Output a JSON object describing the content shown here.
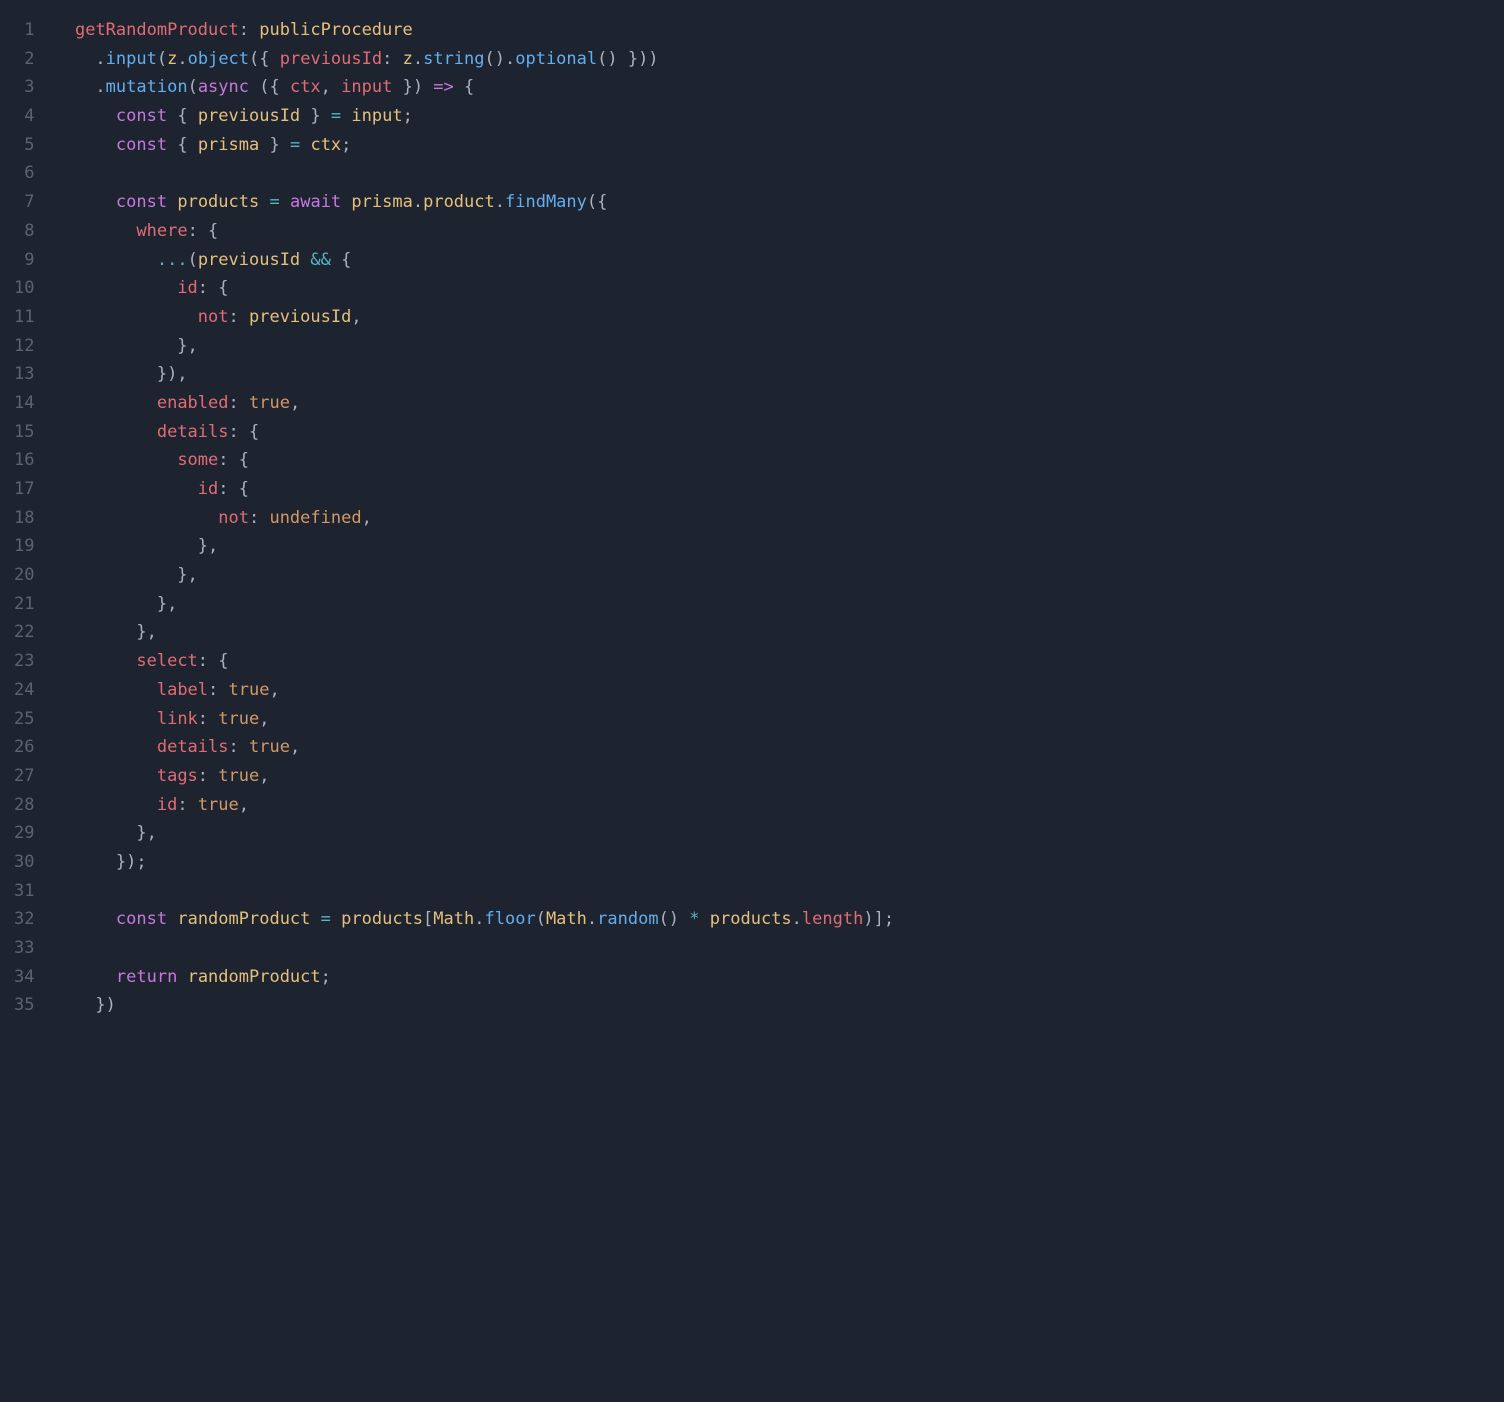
{
  "lineCount": 35,
  "code": {
    "lines": [
      [
        {
          "t": "  ",
          "c": "tk-text"
        },
        {
          "t": "getRandomProduct",
          "c": "tk-prop"
        },
        {
          "t": ": ",
          "c": "tk-punc"
        },
        {
          "t": "publicProcedure",
          "c": "tk-obj"
        }
      ],
      [
        {
          "t": "    .",
          "c": "tk-punc"
        },
        {
          "t": "input",
          "c": "tk-func"
        },
        {
          "t": "(",
          "c": "tk-punc"
        },
        {
          "t": "z",
          "c": "tk-obj"
        },
        {
          "t": ".",
          "c": "tk-punc"
        },
        {
          "t": "object",
          "c": "tk-func"
        },
        {
          "t": "({ ",
          "c": "tk-punc"
        },
        {
          "t": "previousId",
          "c": "tk-prop"
        },
        {
          "t": ": ",
          "c": "tk-punc"
        },
        {
          "t": "z",
          "c": "tk-obj"
        },
        {
          "t": ".",
          "c": "tk-punc"
        },
        {
          "t": "string",
          "c": "tk-func"
        },
        {
          "t": "().",
          "c": "tk-punc"
        },
        {
          "t": "optional",
          "c": "tk-func"
        },
        {
          "t": "() }))",
          "c": "tk-punc"
        }
      ],
      [
        {
          "t": "    .",
          "c": "tk-punc"
        },
        {
          "t": "mutation",
          "c": "tk-func"
        },
        {
          "t": "(",
          "c": "tk-punc"
        },
        {
          "t": "async",
          "c": "tk-kw"
        },
        {
          "t": " ({ ",
          "c": "tk-punc"
        },
        {
          "t": "ctx",
          "c": "tk-id"
        },
        {
          "t": ", ",
          "c": "tk-punc"
        },
        {
          "t": "input",
          "c": "tk-id"
        },
        {
          "t": " }) ",
          "c": "tk-punc"
        },
        {
          "t": "=>",
          "c": "tk-kw"
        },
        {
          "t": " {",
          "c": "tk-punc"
        }
      ],
      [
        {
          "t": "      ",
          "c": "tk-text"
        },
        {
          "t": "const",
          "c": "tk-kw"
        },
        {
          "t": " { ",
          "c": "tk-punc"
        },
        {
          "t": "previousId",
          "c": "tk-obj"
        },
        {
          "t": " } ",
          "c": "tk-punc"
        },
        {
          "t": "=",
          "c": "tk-op"
        },
        {
          "t": " ",
          "c": "tk-text"
        },
        {
          "t": "input",
          "c": "tk-obj"
        },
        {
          "t": ";",
          "c": "tk-punc"
        }
      ],
      [
        {
          "t": "      ",
          "c": "tk-text"
        },
        {
          "t": "const",
          "c": "tk-kw"
        },
        {
          "t": " { ",
          "c": "tk-punc"
        },
        {
          "t": "prisma",
          "c": "tk-obj"
        },
        {
          "t": " } ",
          "c": "tk-punc"
        },
        {
          "t": "=",
          "c": "tk-op"
        },
        {
          "t": " ",
          "c": "tk-text"
        },
        {
          "t": "ctx",
          "c": "tk-obj"
        },
        {
          "t": ";",
          "c": "tk-punc"
        }
      ],
      [],
      [
        {
          "t": "      ",
          "c": "tk-text"
        },
        {
          "t": "const",
          "c": "tk-kw"
        },
        {
          "t": " ",
          "c": "tk-text"
        },
        {
          "t": "products",
          "c": "tk-obj"
        },
        {
          "t": " ",
          "c": "tk-text"
        },
        {
          "t": "=",
          "c": "tk-op"
        },
        {
          "t": " ",
          "c": "tk-text"
        },
        {
          "t": "await",
          "c": "tk-kw"
        },
        {
          "t": " ",
          "c": "tk-text"
        },
        {
          "t": "prisma",
          "c": "tk-obj"
        },
        {
          "t": ".",
          "c": "tk-punc"
        },
        {
          "t": "product",
          "c": "tk-obj"
        },
        {
          "t": ".",
          "c": "tk-punc"
        },
        {
          "t": "findMany",
          "c": "tk-func"
        },
        {
          "t": "({",
          "c": "tk-punc"
        }
      ],
      [
        {
          "t": "        ",
          "c": "tk-text"
        },
        {
          "t": "where",
          "c": "tk-prop"
        },
        {
          "t": ": {",
          "c": "tk-punc"
        }
      ],
      [
        {
          "t": "          ",
          "c": "tk-text"
        },
        {
          "t": "...",
          "c": "tk-op"
        },
        {
          "t": "(",
          "c": "tk-punc"
        },
        {
          "t": "previousId",
          "c": "tk-obj"
        },
        {
          "t": " ",
          "c": "tk-text"
        },
        {
          "t": "&&",
          "c": "tk-op"
        },
        {
          "t": " {",
          "c": "tk-punc"
        }
      ],
      [
        {
          "t": "            ",
          "c": "tk-text"
        },
        {
          "t": "id",
          "c": "tk-prop"
        },
        {
          "t": ": {",
          "c": "tk-punc"
        }
      ],
      [
        {
          "t": "              ",
          "c": "tk-text"
        },
        {
          "t": "not",
          "c": "tk-prop"
        },
        {
          "t": ": ",
          "c": "tk-punc"
        },
        {
          "t": "previousId",
          "c": "tk-obj"
        },
        {
          "t": ",",
          "c": "tk-punc"
        }
      ],
      [
        {
          "t": "            },",
          "c": "tk-punc"
        }
      ],
      [
        {
          "t": "          }),",
          "c": "tk-punc"
        }
      ],
      [
        {
          "t": "          ",
          "c": "tk-text"
        },
        {
          "t": "enabled",
          "c": "tk-prop"
        },
        {
          "t": ": ",
          "c": "tk-punc"
        },
        {
          "t": "true",
          "c": "tk-bool"
        },
        {
          "t": ",",
          "c": "tk-punc"
        }
      ],
      [
        {
          "t": "          ",
          "c": "tk-text"
        },
        {
          "t": "details",
          "c": "tk-prop"
        },
        {
          "t": ": {",
          "c": "tk-punc"
        }
      ],
      [
        {
          "t": "            ",
          "c": "tk-text"
        },
        {
          "t": "some",
          "c": "tk-prop"
        },
        {
          "t": ": {",
          "c": "tk-punc"
        }
      ],
      [
        {
          "t": "              ",
          "c": "tk-text"
        },
        {
          "t": "id",
          "c": "tk-prop"
        },
        {
          "t": ": {",
          "c": "tk-punc"
        }
      ],
      [
        {
          "t": "                ",
          "c": "tk-text"
        },
        {
          "t": "not",
          "c": "tk-prop"
        },
        {
          "t": ": ",
          "c": "tk-punc"
        },
        {
          "t": "undefined",
          "c": "tk-bool"
        },
        {
          "t": ",",
          "c": "tk-punc"
        }
      ],
      [
        {
          "t": "              },",
          "c": "tk-punc"
        }
      ],
      [
        {
          "t": "            },",
          "c": "tk-punc"
        }
      ],
      [
        {
          "t": "          },",
          "c": "tk-punc"
        }
      ],
      [
        {
          "t": "        },",
          "c": "tk-punc"
        }
      ],
      [
        {
          "t": "        ",
          "c": "tk-text"
        },
        {
          "t": "select",
          "c": "tk-prop"
        },
        {
          "t": ": {",
          "c": "tk-punc"
        }
      ],
      [
        {
          "t": "          ",
          "c": "tk-text"
        },
        {
          "t": "label",
          "c": "tk-prop"
        },
        {
          "t": ": ",
          "c": "tk-punc"
        },
        {
          "t": "true",
          "c": "tk-bool"
        },
        {
          "t": ",",
          "c": "tk-punc"
        }
      ],
      [
        {
          "t": "          ",
          "c": "tk-text"
        },
        {
          "t": "link",
          "c": "tk-prop"
        },
        {
          "t": ": ",
          "c": "tk-punc"
        },
        {
          "t": "true",
          "c": "tk-bool"
        },
        {
          "t": ",",
          "c": "tk-punc"
        }
      ],
      [
        {
          "t": "          ",
          "c": "tk-text"
        },
        {
          "t": "details",
          "c": "tk-prop"
        },
        {
          "t": ": ",
          "c": "tk-punc"
        },
        {
          "t": "true",
          "c": "tk-bool"
        },
        {
          "t": ",",
          "c": "tk-punc"
        }
      ],
      [
        {
          "t": "          ",
          "c": "tk-text"
        },
        {
          "t": "tags",
          "c": "tk-prop"
        },
        {
          "t": ": ",
          "c": "tk-punc"
        },
        {
          "t": "true",
          "c": "tk-bool"
        },
        {
          "t": ",",
          "c": "tk-punc"
        }
      ],
      [
        {
          "t": "          ",
          "c": "tk-text"
        },
        {
          "t": "id",
          "c": "tk-prop"
        },
        {
          "t": ": ",
          "c": "tk-punc"
        },
        {
          "t": "true",
          "c": "tk-bool"
        },
        {
          "t": ",",
          "c": "tk-punc"
        }
      ],
      [
        {
          "t": "        },",
          "c": "tk-punc"
        }
      ],
      [
        {
          "t": "      });",
          "c": "tk-punc"
        }
      ],
      [],
      [
        {
          "t": "      ",
          "c": "tk-text"
        },
        {
          "t": "const",
          "c": "tk-kw"
        },
        {
          "t": " ",
          "c": "tk-text"
        },
        {
          "t": "randomProduct",
          "c": "tk-obj"
        },
        {
          "t": " ",
          "c": "tk-text"
        },
        {
          "t": "=",
          "c": "tk-op"
        },
        {
          "t": " ",
          "c": "tk-text"
        },
        {
          "t": "products",
          "c": "tk-obj"
        },
        {
          "t": "[",
          "c": "tk-punc"
        },
        {
          "t": "Math",
          "c": "tk-obj"
        },
        {
          "t": ".",
          "c": "tk-punc"
        },
        {
          "t": "floor",
          "c": "tk-func"
        },
        {
          "t": "(",
          "c": "tk-punc"
        },
        {
          "t": "Math",
          "c": "tk-obj"
        },
        {
          "t": ".",
          "c": "tk-punc"
        },
        {
          "t": "random",
          "c": "tk-func"
        },
        {
          "t": "() ",
          "c": "tk-punc"
        },
        {
          "t": "*",
          "c": "tk-op"
        },
        {
          "t": " ",
          "c": "tk-text"
        },
        {
          "t": "products",
          "c": "tk-obj"
        },
        {
          "t": ".",
          "c": "tk-punc"
        },
        {
          "t": "length",
          "c": "tk-prop"
        },
        {
          "t": ")];",
          "c": "tk-punc"
        }
      ],
      [],
      [
        {
          "t": "      ",
          "c": "tk-text"
        },
        {
          "t": "return",
          "c": "tk-kw"
        },
        {
          "t": " ",
          "c": "tk-text"
        },
        {
          "t": "randomProduct",
          "c": "tk-obj"
        },
        {
          "t": ";",
          "c": "tk-punc"
        }
      ],
      [
        {
          "t": "    })",
          "c": "tk-punc"
        }
      ]
    ]
  }
}
